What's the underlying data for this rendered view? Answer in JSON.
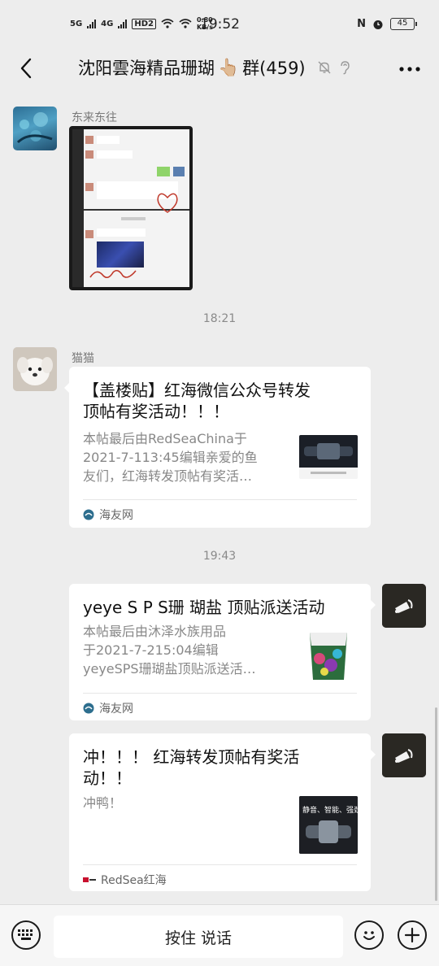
{
  "status_bar": {
    "network_1": "5G",
    "network_2": "4G",
    "hd": "HD2",
    "speed": "0.80 KB/s",
    "time": "19:52",
    "battery": "45"
  },
  "header": {
    "title": "沈阳雲海精品珊瑚",
    "emoji": "👆🏼",
    "title_suffix": "群(459)",
    "back_icon": "back-arrow-icon",
    "mute_icon": "bell-off-icon",
    "ear_icon": "ear-icon",
    "more_icon": "more-icon"
  },
  "messages": [
    {
      "type": "image",
      "sender": "东来东往",
      "side": "left"
    },
    {
      "type": "time",
      "text": "18:21"
    },
    {
      "type": "link",
      "sender": "猫猫",
      "side": "left",
      "title": "【盖楼贴】红海微信公众号转发顶帖有奖活动！！！",
      "title_l1": "【盖楼贴】红海微信公众号转发",
      "title_l2": "顶帖有奖活动！！！",
      "desc_l1": "本帖最后由RedSeaChina于",
      "desc_l2": "2021-7-113:45编辑亲爱的鱼",
      "desc_l3": "友们，红海转发顶帖有奖活…",
      "source": "海友网"
    },
    {
      "type": "time",
      "text": "19:43"
    },
    {
      "type": "link",
      "side": "right",
      "title": "yeye S P S珊 瑚盐 顶贴派送活动",
      "desc_l1": "本帖最后由沐泽水族用品",
      "desc_l2": "于2021-7-215:04编辑",
      "desc_l3": "yeyeSPS珊瑚盐顶贴派送活…",
      "source": "海友网"
    },
    {
      "type": "link",
      "side": "right",
      "title_l1": "冲！！！ 红海转发顶帖有奖活",
      "title_l2": "动！！",
      "desc_l1": "冲鸭！",
      "thumb_text": "静音、智能、强劲",
      "source": "RedSea红海"
    }
  ],
  "bottom_bar": {
    "voice_label": "按住 说话",
    "keyboard_icon": "keyboard-icon",
    "emoji_icon": "emoji-icon",
    "plus_icon": "plus-icon"
  },
  "colors": {
    "background": "#ededed",
    "bubble": "#ffffff",
    "accent": "#07c160"
  }
}
